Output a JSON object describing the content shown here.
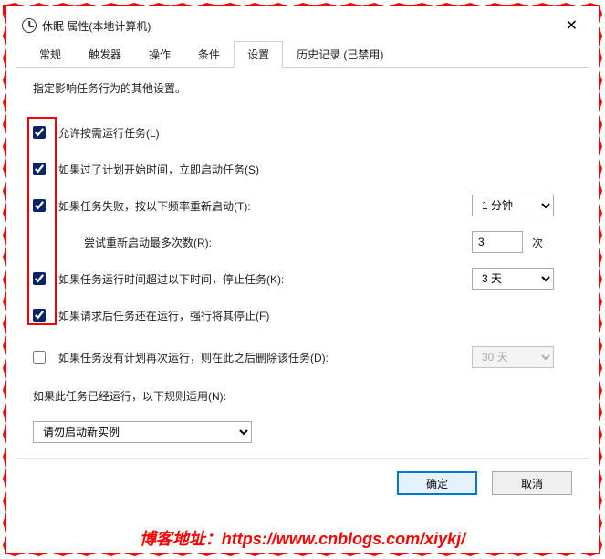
{
  "window": {
    "title": "休眠 属性(本地计算机)",
    "close": "✕"
  },
  "tabs": [
    {
      "label": "常规"
    },
    {
      "label": "触发器"
    },
    {
      "label": "操作"
    },
    {
      "label": "条件"
    },
    {
      "label": "设置",
      "active": true
    },
    {
      "label": "历史记录 (已禁用)"
    }
  ],
  "description": "指定影响任务行为的其他设置。",
  "fields": {
    "allow_demand": {
      "checked": true,
      "label": "允许按需运行任务(L)"
    },
    "run_asap": {
      "checked": true,
      "label": "如果过了计划开始时间，立即启动任务(S)"
    },
    "restart_fail": {
      "checked": true,
      "label": "如果任务失败，按以下频率重新启动(T):",
      "value": "1 分钟"
    },
    "retry_count": {
      "label": "尝试重新启动最多次数(R):",
      "value": "3",
      "suffix": "次"
    },
    "stop_runtime": {
      "checked": true,
      "label": "如果任务运行时间超过以下时间，停止任务(K):",
      "value": "3 天"
    },
    "force_stop": {
      "checked": true,
      "label": "如果请求后任务还在运行，强行将其停止(F)"
    },
    "delete_after": {
      "checked": false,
      "label": "如果任务没有计划再次运行，则在此之后删除该任务(D):",
      "value": "30 天"
    },
    "already_running": {
      "label": "如果此任务已经运行，以下规则适用(N):",
      "value": "请勿启动新实例"
    }
  },
  "buttons": {
    "ok": "确定",
    "cancel": "取消"
  },
  "watermark": "博客地址：https://www.cnblogs.com/xiykj/"
}
